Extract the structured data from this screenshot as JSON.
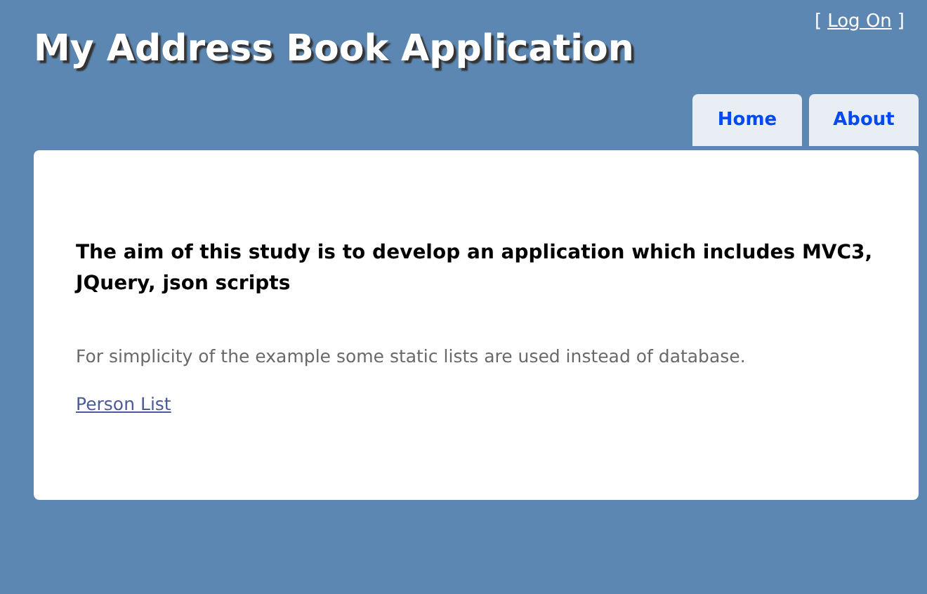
{
  "header": {
    "title": "My Address Book Application",
    "login": {
      "open": "[",
      "link": "Log On",
      "close": "]"
    }
  },
  "tabs": [
    {
      "label": "Home"
    },
    {
      "label": "About"
    }
  ],
  "main": {
    "heading": "The aim of this study is to develop an application which includes MVC3, JQuery, json scripts",
    "note": "For simplicity of the example some static lists are used instead of database.",
    "link": "Person List"
  }
}
